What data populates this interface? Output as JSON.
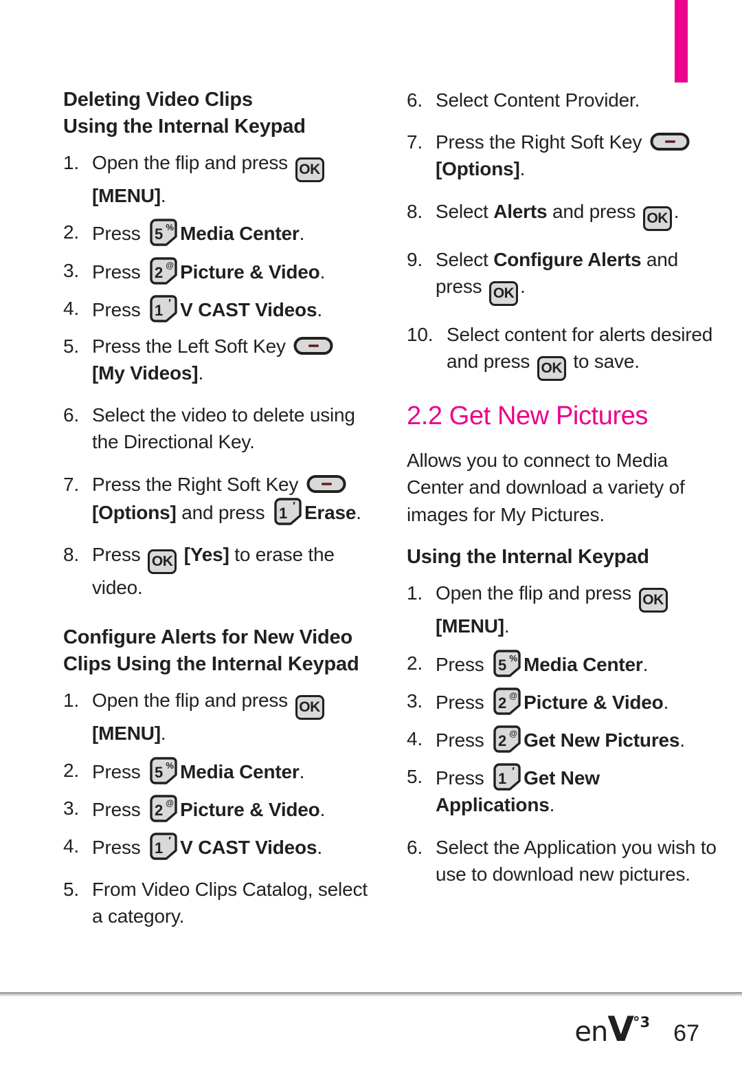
{
  "page": {
    "number": "67",
    "logo_text": "enV",
    "logo_superscript": "°3",
    "accent_color": "#ec008c"
  },
  "left_column": {
    "heading_line1": "Deleting Video Clips",
    "heading_line2": "Using the Internal Keypad",
    "delete_steps": [
      {
        "num": "1.",
        "pre": "Open the flip and press ",
        "key": "ok",
        "post": "",
        "line2_bold": "[MENU]",
        "line2_post": "."
      },
      {
        "num": "2.",
        "pre": "Press ",
        "key": "5",
        "post_bold": "Media Center",
        "post": "."
      },
      {
        "num": "3.",
        "pre": "Press ",
        "key": "2",
        "post_bold": "Picture & Video",
        "post": "."
      },
      {
        "num": "4.",
        "pre": "Press ",
        "key": "1",
        "post_bold": "V CAST Videos",
        "post": "."
      },
      {
        "num": "5.",
        "pre": "Press the Left Soft Key ",
        "key": "soft",
        "line2_bold": "[My Videos]",
        "line2_post": "."
      },
      {
        "num": "6.",
        "pre": "Select the video to delete using the Directional Key."
      },
      {
        "num": "7.",
        "pre": "Press the Right Soft Key ",
        "key": "soft",
        "line2_bold": "[Options]",
        "line2_mid": " and press ",
        "key2": "1",
        "line2_bold2": "Erase",
        "line2_post": "."
      },
      {
        "num": "8.",
        "pre": "Press ",
        "key": "ok",
        "post_bold": "[Yes]",
        "post": " to erase the video."
      }
    ],
    "configure_heading_line1": "Configure Alerts for New Video",
    "configure_heading_line2": "Clips Using the Internal Keypad",
    "configure_steps": [
      {
        "num": "1.",
        "pre": "Open the flip and press ",
        "key": "ok",
        "line2_bold": "[MENU]",
        "line2_post": "."
      },
      {
        "num": "2.",
        "pre": "Press ",
        "key": "5",
        "post_bold": "Media Center",
        "post": "."
      },
      {
        "num": "3.",
        "pre": "Press ",
        "key": "2",
        "post_bold": "Picture & Video",
        "post": "."
      },
      {
        "num": "4.",
        "pre": "Press ",
        "key": "1",
        "post_bold": "V CAST Videos",
        "post": "."
      },
      {
        "num": "5.",
        "pre": "From Video Clips Catalog, select a category."
      }
    ]
  },
  "right_column": {
    "continued_steps": [
      {
        "num": "6.",
        "pre": "Select Content Provider."
      },
      {
        "num": "7.",
        "pre": "Press the Right Soft Key ",
        "key": "soft",
        "line2_bold": "[Options]",
        "line2_post": "."
      },
      {
        "num": "8.",
        "pre": "Select ",
        "bold": "Alerts",
        "mid": " and press ",
        "key": "ok",
        "post": "."
      },
      {
        "num": "9.",
        "pre": "Select ",
        "bold": "Configure Alerts",
        "mid": " and",
        "line2_pre": "press ",
        "key": "ok",
        "line2_post": "."
      },
      {
        "num": "10.",
        "pre": "Select content for alerts desired and press ",
        "key": "ok",
        "post": " to save."
      }
    ],
    "section_heading": "2.2 Get New Pictures",
    "intro_paragraph": "Allows you to connect to Media Center and download a variety of images for My Pictures.",
    "keypad_heading": "Using the Internal Keypad",
    "pictures_steps": [
      {
        "num": "1.",
        "pre": "Open the flip and press ",
        "key": "ok",
        "line2_bold": "[MENU]",
        "line2_post": "."
      },
      {
        "num": "2.",
        "pre": "Press ",
        "key": "5",
        "post_bold": "Media Center",
        "post": "."
      },
      {
        "num": "3.",
        "pre": "Press ",
        "key": "2",
        "post_bold": "Picture & Video",
        "post": "."
      },
      {
        "num": "4.",
        "pre": "Press ",
        "key": "2",
        "post_bold": "Get New Pictures",
        "post": "."
      },
      {
        "num": "5.",
        "pre": "Press ",
        "key": "1",
        "post_bold": "Get New Applications",
        "post": "."
      },
      {
        "num": "6.",
        "pre": "Select the Application you wish to use to download new pictures."
      }
    ]
  },
  "keys": {
    "ok": {
      "label": "OK",
      "name": "ok-key"
    },
    "k1": {
      "digit": "1",
      "sup": "′",
      "name": "number-key-1"
    },
    "k2": {
      "digit": "2",
      "sup": "@",
      "name": "number-key-2"
    },
    "k5": {
      "digit": "5",
      "sup": "%",
      "name": "number-key-5"
    },
    "soft": {
      "name": "soft-key"
    }
  }
}
